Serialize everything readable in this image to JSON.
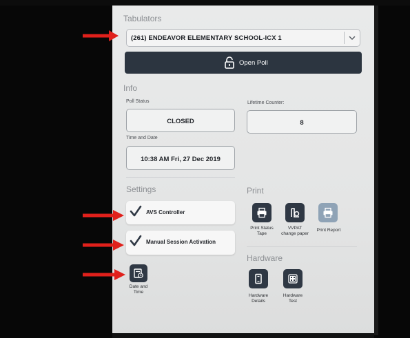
{
  "tabulators": {
    "section_title": "Tabulators",
    "selected": "(261) ENDEAVOR ELEMENTARY SCHOOL-ICX 1",
    "open_poll_label": "Open Poll"
  },
  "info": {
    "section_title": "Info",
    "poll_status_label": "Poll Status",
    "poll_status_value": "CLOSED",
    "lifetime_counter_label": "Lifetime Counter:",
    "lifetime_counter_value": "8",
    "time_date_label": "Time and Date",
    "time_date_value": "10:38 AM   Fri, 27 Dec 2019"
  },
  "settings": {
    "section_title": "Settings",
    "avs_controller": "AVS Controller",
    "manual_session_activation": "Manual Session Activation",
    "date_and_time_line1": "Date and",
    "date_and_time_line2": "Time"
  },
  "print": {
    "section_title": "Print",
    "status_tape_line1": "Print Status",
    "status_tape_line2": "Tape",
    "vvpat_line1": "VVPAT",
    "vvpat_line2": "change paper",
    "report": "Print Report"
  },
  "hardware": {
    "section_title": "Hardware",
    "details_line1": "Hardware",
    "details_line2": "Details",
    "test_line1": "Hardware",
    "test_line2": "Test"
  },
  "colors": {
    "accent_dark": "#2c3540",
    "disabled_button": "#8fa3b6",
    "annotation_arrow": "#e0201b"
  }
}
